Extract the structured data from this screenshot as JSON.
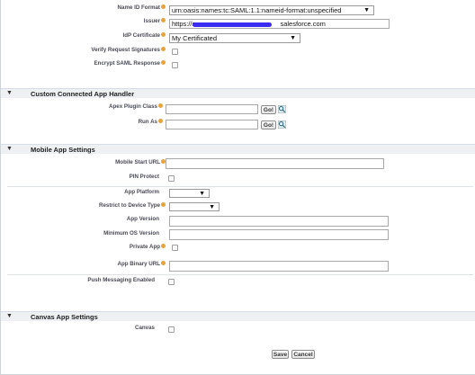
{
  "saml": {
    "name_id_format": {
      "label": "Name ID Format",
      "value": "urn:oasis:names:tc:SAML:1.1:nameid-format:unspecified"
    },
    "issuer": {
      "label": "Issuer",
      "value_prefix": "https://sa",
      "value_suffix": "salesforce.com"
    },
    "idp_certificate": {
      "label": "IdP Certificate",
      "value": "My Certificated"
    },
    "verify_request_signatures": {
      "label": "Verify Request Signatures",
      "checked": false
    },
    "encrypt_saml_response": {
      "label": "Encrypt SAML Response",
      "checked": false
    }
  },
  "custom_handler": {
    "title": "Custom Connected App Handler",
    "apex_plugin_class": {
      "label": "Apex Plugin Class",
      "value": "",
      "go_label": "Go!"
    },
    "run_as": {
      "label": "Run As",
      "value": "",
      "go_label": "Go!"
    }
  },
  "mobile": {
    "title": "Mobile App Settings",
    "mobile_start_url": {
      "label": "Mobile Start URL",
      "value": ""
    },
    "pin_protect": {
      "label": "PIN Protect",
      "checked": false
    },
    "app_platform": {
      "label": "App Platform",
      "value": ""
    },
    "restrict_device_type": {
      "label": "Restrict to Device Type",
      "value": ""
    },
    "app_version": {
      "label": "App Version",
      "value": ""
    },
    "minimum_os_version": {
      "label": "Minimum OS Version",
      "value": ""
    },
    "private_app": {
      "label": "Private App",
      "checked": false
    },
    "app_binary_url": {
      "label": "App Binary URL",
      "value": ""
    },
    "push_messaging_enabled": {
      "label": "Push Messaging Enabled",
      "checked": false
    }
  },
  "canvas": {
    "title": "Canvas App Settings",
    "canvas": {
      "label": "Canvas",
      "checked": false
    }
  },
  "footer": {
    "save_label": "Save",
    "cancel_label": "Cancel"
  },
  "icons": {
    "collapse": "triangle-down-icon",
    "help": "help-bubble-icon",
    "lookup": "magnifier-icon"
  },
  "colors": {
    "help": "#e8a33d",
    "section_bg": "#eef0f3"
  }
}
